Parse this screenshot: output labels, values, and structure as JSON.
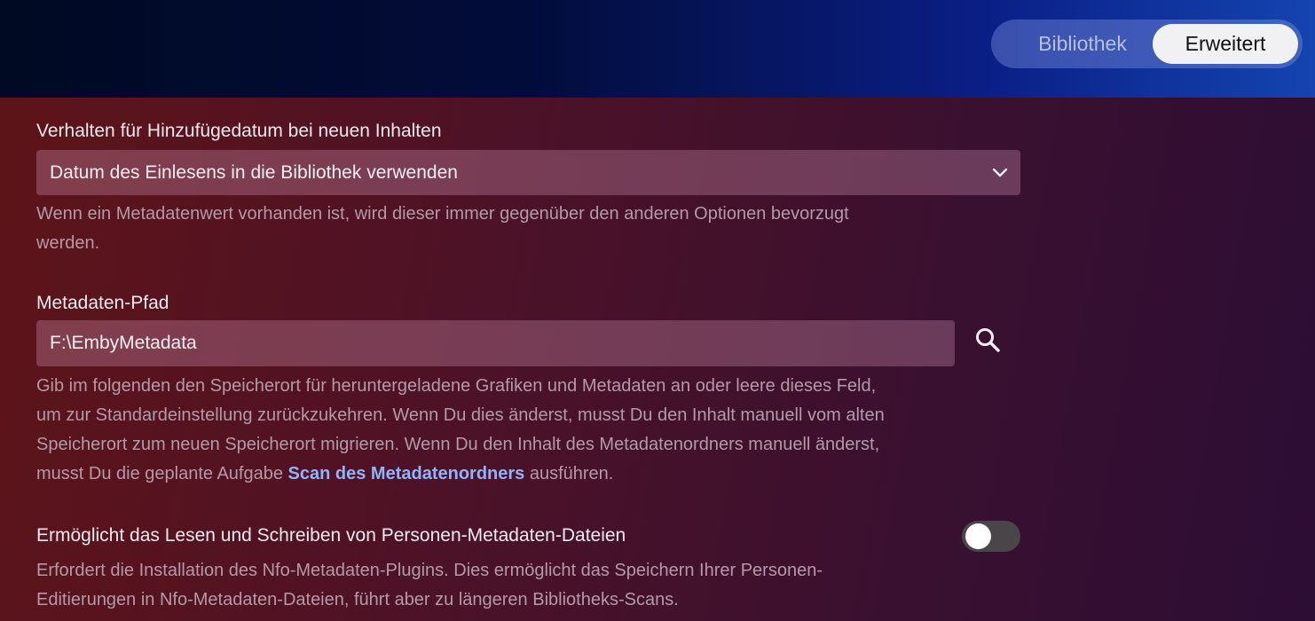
{
  "header": {
    "tabs": [
      {
        "label": "Bibliothek",
        "active": false
      },
      {
        "label": "Erweitert",
        "active": true
      }
    ]
  },
  "date_added": {
    "label": "Verhalten für Hinzufügedatum bei neuen Inhalten",
    "selected_value": "Datum des Einlesens in die Bibliothek verwenden",
    "description_line1": "Wenn ein Metadatenwert vorhanden ist, wird dieser immer gegenüber den anderen Optionen bevorzugt",
    "description_line2": "werden."
  },
  "metadata_path": {
    "label": "Metadaten-Pfad",
    "value": "F:\\EmbyMetadata",
    "description_line1": "Gib im folgenden den Speicherort für heruntergeladene Grafiken und Metadaten an oder leere dieses Feld,",
    "description_line2": "um zur Standardeinstellung zurückzukehren. Wenn Du dies änderst, musst Du den Inhalt manuell vom alten",
    "description_line3": "Speicherort zum neuen Speicherort migrieren. Wenn Du den Inhalt des Metadatenordners manuell änderst,",
    "description_line4_prefix": "musst Du die geplante Aufgabe ",
    "description_link": "Scan des Metadatenordners",
    "description_line4_suffix": " ausführen."
  },
  "person_metadata": {
    "label": "Ermöglicht das Lesen und Schreiben von Personen-Metadaten-Dateien",
    "enabled": false,
    "description_line1": "Erfordert die Installation des Nfo-Metadaten-Plugins. Dies ermöglicht das Speichern Ihrer Personen-",
    "description_line2": "Editierungen in Nfo-Metadaten-Dateien, führt aber zu längeren Bibliotheks-Scans."
  },
  "icons": {
    "dropdown": "chevron-down-icon",
    "search": "search-icon"
  }
}
